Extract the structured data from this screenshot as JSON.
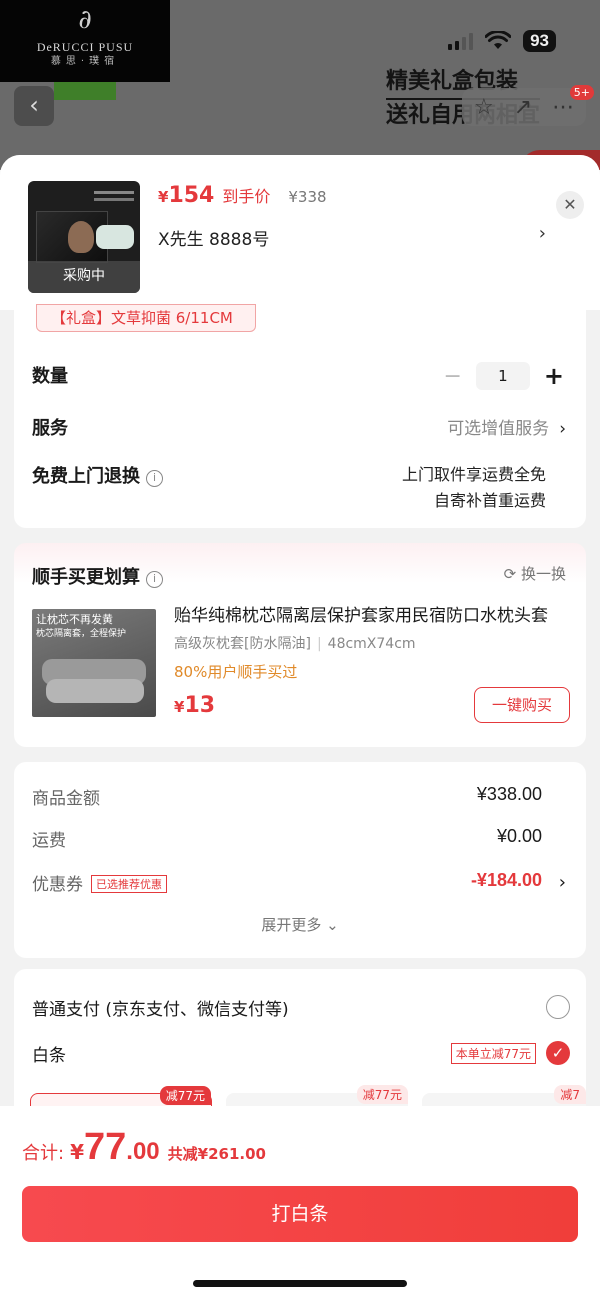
{
  "background": {
    "logo": {
      "mark": "∂",
      "name": "DeRUCCI PUSU",
      "sub": "慕思·璞宿"
    },
    "battery": "93",
    "promo_line1": "精美礼盒包装",
    "promo_line2": "送礼自用两相宜",
    "cart_badge": "5+"
  },
  "product": {
    "thumb_label": "采购中",
    "price_currency": "¥",
    "price": "154",
    "price_tag": "到手价",
    "original_price": "¥338",
    "spec": "X先生  8888号",
    "prev_spec_chip": "【礼盒】文草抑菌 6/11CM"
  },
  "options": {
    "quantity_label": "数量",
    "quantity": "1",
    "service_label": "服务",
    "service_value": "可选增值服务",
    "return_label": "免费上门退换",
    "return_line1": "上门取件享运费全免",
    "return_line2": "自寄补首重运费"
  },
  "addon": {
    "title": "顺手买更划算",
    "swap": "换一换",
    "img_caption": "让枕芯不再发黄",
    "img_caption2": "枕芯隔离套，全程保护",
    "name": "贻华纯棉枕芯隔离层保护套家用民宿防口水枕头套",
    "spec_main": "高级灰枕套[防水隔油]",
    "spec_size": "48cmX74cm",
    "popularity": "80%用户顺手买过",
    "price_currency": "¥",
    "price": "13",
    "buy_label": "一键购买"
  },
  "amounts": {
    "goods_label": "商品金额",
    "goods_value": "¥338.00",
    "shipping_label": "运费",
    "shipping_value": "¥0.00",
    "coupon_label": "优惠券",
    "coupon_badge": "已选推荐优惠",
    "coupon_value": "-¥184.00",
    "expand_label": "展开更多"
  },
  "payment": {
    "normal_label": "普通支付 (京东支付、微信支付等)",
    "baitiao_label": "白条",
    "baitiao_promo": "本单立减77元",
    "plans": [
      {
        "tag": "减77元"
      },
      {
        "tag": "减77元"
      },
      {
        "tag": "减7"
      }
    ]
  },
  "footer": {
    "total_label": "合计:",
    "currency": "¥",
    "total_int": "77",
    "total_dec": ".00",
    "saved": "共减¥261.00",
    "pay_button": "打白条"
  },
  "colors": {
    "accent": "#e4393c",
    "orange": "#e08a2a"
  }
}
